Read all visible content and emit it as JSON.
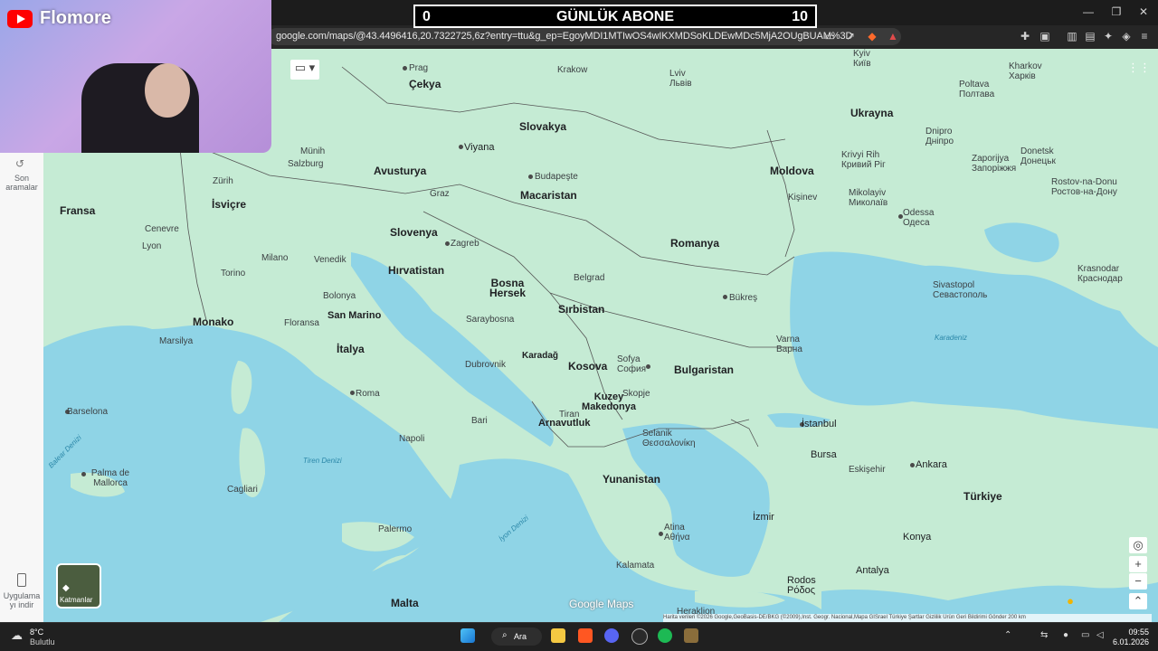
{
  "overlay": {
    "score_left": "0",
    "score_title": "GÜNLÜK ABONE",
    "score_right": "10",
    "channel_name": "Flomore"
  },
  "browser": {
    "url": "google.com/maps/@43.4496416,20.7322725,6z?entry=ttu&g_ep=EgoyMDI1MTIwOS4wIKXMDSoKLDEwMDc5MjA2OUgBUAM%3D"
  },
  "sidebar": {
    "recent_label_1": "Son",
    "recent_label_2": "aramalar",
    "app_label_1": "Uygulama",
    "app_label_2": "yı indir"
  },
  "map": {
    "layers_label": "Katmanlar",
    "logo": "Google Maps",
    "attribution": "Harita verileri ©2026 Google,GeoBasis-DE/BKG (©2009),Inst. Geogr. Nacional,Mapa GISrael   Türkiye   Şartlar   Gizlilik   Ürün Geri Bildirimi Gönder   200 km",
    "countries": [
      "Çekya",
      "Slovakya",
      "Avusturya",
      "Macaristan",
      "İsviçre",
      "Fransa",
      "Slovenya",
      "Hırvatistan",
      "Bosna Hersek",
      "Sırbistan",
      "Romanya",
      "Moldova",
      "Ukrayna",
      "Bulgaristan",
      "Kosova",
      "Karadağ",
      "Kuzey Makedonya",
      "Arnavutluk",
      "Yunanistan",
      "Türkiye",
      "İtalya",
      "San Marino",
      "Monako",
      "Malta"
    ],
    "cities": [
      "Prag",
      "Krakow",
      "Lviv Львів",
      "Kyiv Київ",
      "Kharkov Харків",
      "Poltava Полтава",
      "Viyana",
      "Budapeşte",
      "Zagreb",
      "Bükreş",
      "Sofya София",
      "Atina Αθήνα",
      "İstanbul",
      "Ankara",
      "Roma",
      "Napoli",
      "Barselona",
      "Palma de Mallorca",
      "Cagliari",
      "Odessa Одеса",
      "Dnipro Дніпро",
      "Donetsk Донецьк",
      "Zaporijya Запоріжжя",
      "Krivyi Rih Кривий Ріг",
      "Mikolayiv Миколаїв",
      "Kişinev",
      "Sivastopol Севастополь",
      "Krasnodar Краснодар",
      "Rostov-na-Donu Ростов-на-Дону",
      "Selanik Θεσσαλονίκη",
      "İzmir",
      "Bursa",
      "Eskişehir",
      "Konya",
      "Antalya",
      "Palermo",
      "Varna Варна",
      "Milano",
      "Torino",
      "Cenevre",
      "Lyon",
      "Marsilya",
      "Floransa",
      "Bolonya",
      "Venedik",
      "Saraybosna",
      "Belgrad",
      "Tiran",
      "Skopje",
      "Zürih",
      "Münih",
      "Salzburg",
      "Graz",
      "Dubrovnik",
      "Bari",
      "Kalamata",
      "Rodos Ρόδος",
      "Heraklion"
    ],
    "seas": [
      "Karadeniz",
      "Tiren Denizi",
      "İyon Denizi",
      "Balear Denizi"
    ]
  },
  "taskbar": {
    "weather_temp": "8°C",
    "weather_desc": "Bulutlu",
    "search": "Ara",
    "time": "09:55",
    "date": "6.01.2026"
  }
}
